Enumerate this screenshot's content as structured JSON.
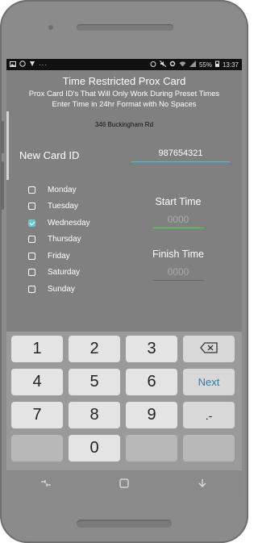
{
  "status_bar": {
    "left_icons": [
      "gallery-icon",
      "whatsapp-icon",
      "shield-icon",
      "more-dots-icon"
    ],
    "right_icons": [
      "alarm-icon",
      "mute-icon",
      "gear-icon",
      "wifi-icon",
      "signal-icon",
      "battery-icon"
    ],
    "battery": "55%",
    "time": "13:37"
  },
  "header": {
    "title": "Time Restricted Prox Card",
    "subtitle_line1": "Prox Card ID's That Will Only Work During Preset Times",
    "subtitle_line2": "Enter Time in 24hr Format with No Spaces"
  },
  "address": "346 Buckingham Rd",
  "card": {
    "label": "New Card ID",
    "value": "987654321"
  },
  "days": [
    {
      "label": "Monday",
      "checked": false
    },
    {
      "label": "Tuesday",
      "checked": false
    },
    {
      "label": "Wednesday",
      "checked": true
    },
    {
      "label": "Thursday",
      "checked": false
    },
    {
      "label": "Friday",
      "checked": false
    },
    {
      "label": "Saturday",
      "checked": false
    },
    {
      "label": "Sunday",
      "checked": false
    }
  ],
  "start_time": {
    "label": "Start Time",
    "placeholder": "0000"
  },
  "finish_time": {
    "label": "Finish Time",
    "placeholder": "0000"
  },
  "keyboard": {
    "keys": [
      "1",
      "2",
      "3",
      "4",
      "5",
      "6",
      "7",
      "8",
      "9",
      "0"
    ],
    "next_label": "Next",
    "punct_label": ".-",
    "backspace_icon": "backspace-icon"
  },
  "navbar": {
    "icons": [
      "recents-icon",
      "home-icon",
      "back-icon"
    ]
  },
  "colors": {
    "accent": "#6cc6cf",
    "start_underline": "#6bbf6b",
    "finish_underline": "#c43c3c",
    "next_key": "#2a7fa8"
  }
}
